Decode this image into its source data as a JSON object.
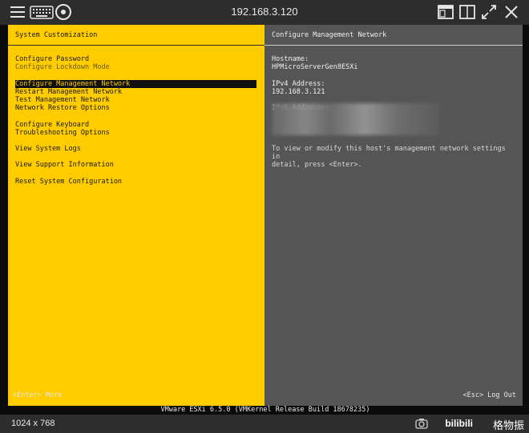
{
  "toolbar": {
    "host_ip": "192.168.3.120",
    "icons": [
      "menu-icon",
      "keyboard-icon",
      "disc-icon",
      "window-icon",
      "split-window-icon",
      "fullscreen-icon",
      "close-icon"
    ]
  },
  "left_pane": {
    "title": "System Customization",
    "menu": [
      {
        "label": "Configure Password"
      },
      {
        "label": "Configure Lockdown Mode",
        "dim": true
      },
      {
        "gap": true
      },
      {
        "label": "Configure Management Network",
        "selected": true
      },
      {
        "label": "Restart Management Network"
      },
      {
        "label": "Test Management Network"
      },
      {
        "label": "Network Restore Options"
      },
      {
        "gap": true
      },
      {
        "label": "Configure Keyboard"
      },
      {
        "label": "Troubleshooting Options"
      },
      {
        "gap": true
      },
      {
        "label": "View System Logs"
      },
      {
        "gap": true
      },
      {
        "label": "View Support Information"
      },
      {
        "gap": true
      },
      {
        "label": "Reset System Configuration"
      }
    ],
    "footer": "<Enter> More"
  },
  "right_pane": {
    "title": "Configure Management Network",
    "hostname_label": "Hostname:",
    "hostname": "HPMicroServerGen8ESXi",
    "ipv4_label": "IPv4 Address:",
    "ipv4": "192.168.3.121",
    "ipv6_label": "IPv6 Addresses:",
    "hint_line1": "To view or modify this host's management network settings in",
    "hint_line2": "detail, press <Enter>.",
    "footer": "<Esc> Log Out"
  },
  "build_bar": "VMware ESXi 6.5.0 (VMKernel Release Build 18678235)",
  "statusbar": {
    "resolution": "1024 x 768",
    "watermark_logo": "bilibili",
    "watermark_text": "格物振"
  },
  "colors": {
    "left_pane_bg": "#ffcc00",
    "right_pane_bg": "#555555",
    "toolbar_bg": "#2d2d2d"
  }
}
